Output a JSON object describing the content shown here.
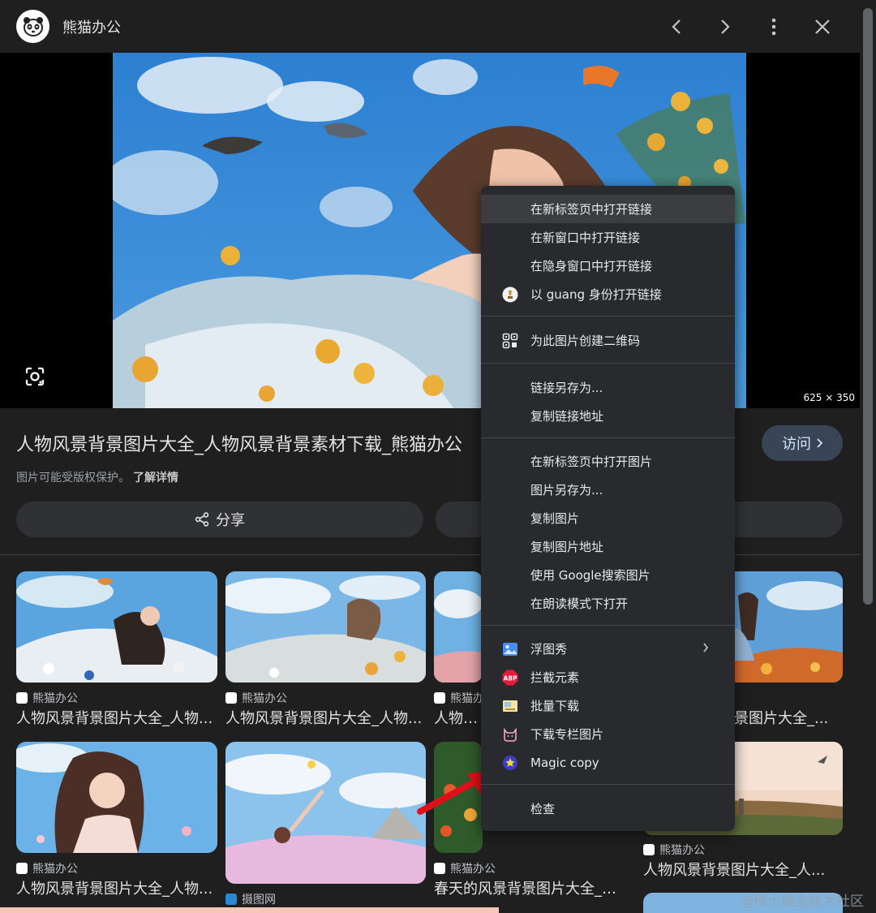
{
  "header": {
    "site_name": "熊猫办公"
  },
  "preview": {
    "dimensions": "625 × 350"
  },
  "result": {
    "title": "人物风景背景图片大全_人物风景背景素材下载_熊猫办公",
    "copyright": "图片可能受版权保护。",
    "learn_more": "了解详情",
    "visit_label": "访问",
    "share_label": "分享"
  },
  "grid": [
    {
      "source": "熊猫办公",
      "caption": "人物风景背景图片大全_人物..."
    },
    {
      "source": "熊猫办公",
      "caption": "人物风景背景图片大全_人物..."
    },
    {
      "source": "熊猫办",
      "caption": "人物风景"
    },
    {
      "source": "",
      "caption": "景图片大全_..."
    },
    {
      "source": "熊猫办公",
      "caption": "人物风景背景图片大全_人物..."
    },
    {
      "source": "摄图网",
      "caption": ""
    },
    {
      "source": "熊猫办公",
      "caption": "春天的风景背景图片大全_春..."
    },
    {
      "source": "熊猫办公",
      "caption": "人物风景背景图片大全_人..."
    }
  ],
  "watermark": "@稀土掘金技术社区",
  "menu": {
    "group1": [
      "在新标签页中打开链接",
      "在新窗口中打开链接",
      "在隐身窗口中打开链接",
      "以 guang 身份打开链接"
    ],
    "group2": [
      "为此图片创建二维码"
    ],
    "group3": [
      "链接另存为...",
      "复制链接地址"
    ],
    "group4": [
      "在新标签页中打开图片",
      "图片另存为...",
      "复制图片",
      "复制图片地址",
      "使用 Google搜索图片",
      "在朗读模式下打开"
    ],
    "group5": [
      "浮图秀",
      "拦截元素",
      "批量下载",
      "下载专栏图片",
      "Magic copy"
    ],
    "group6": [
      "检查"
    ],
    "abp_badge": "ABP"
  },
  "colors": {
    "accent": "#394457",
    "accent_text": "#d3e3fd",
    "arrow": "#e0101a"
  }
}
